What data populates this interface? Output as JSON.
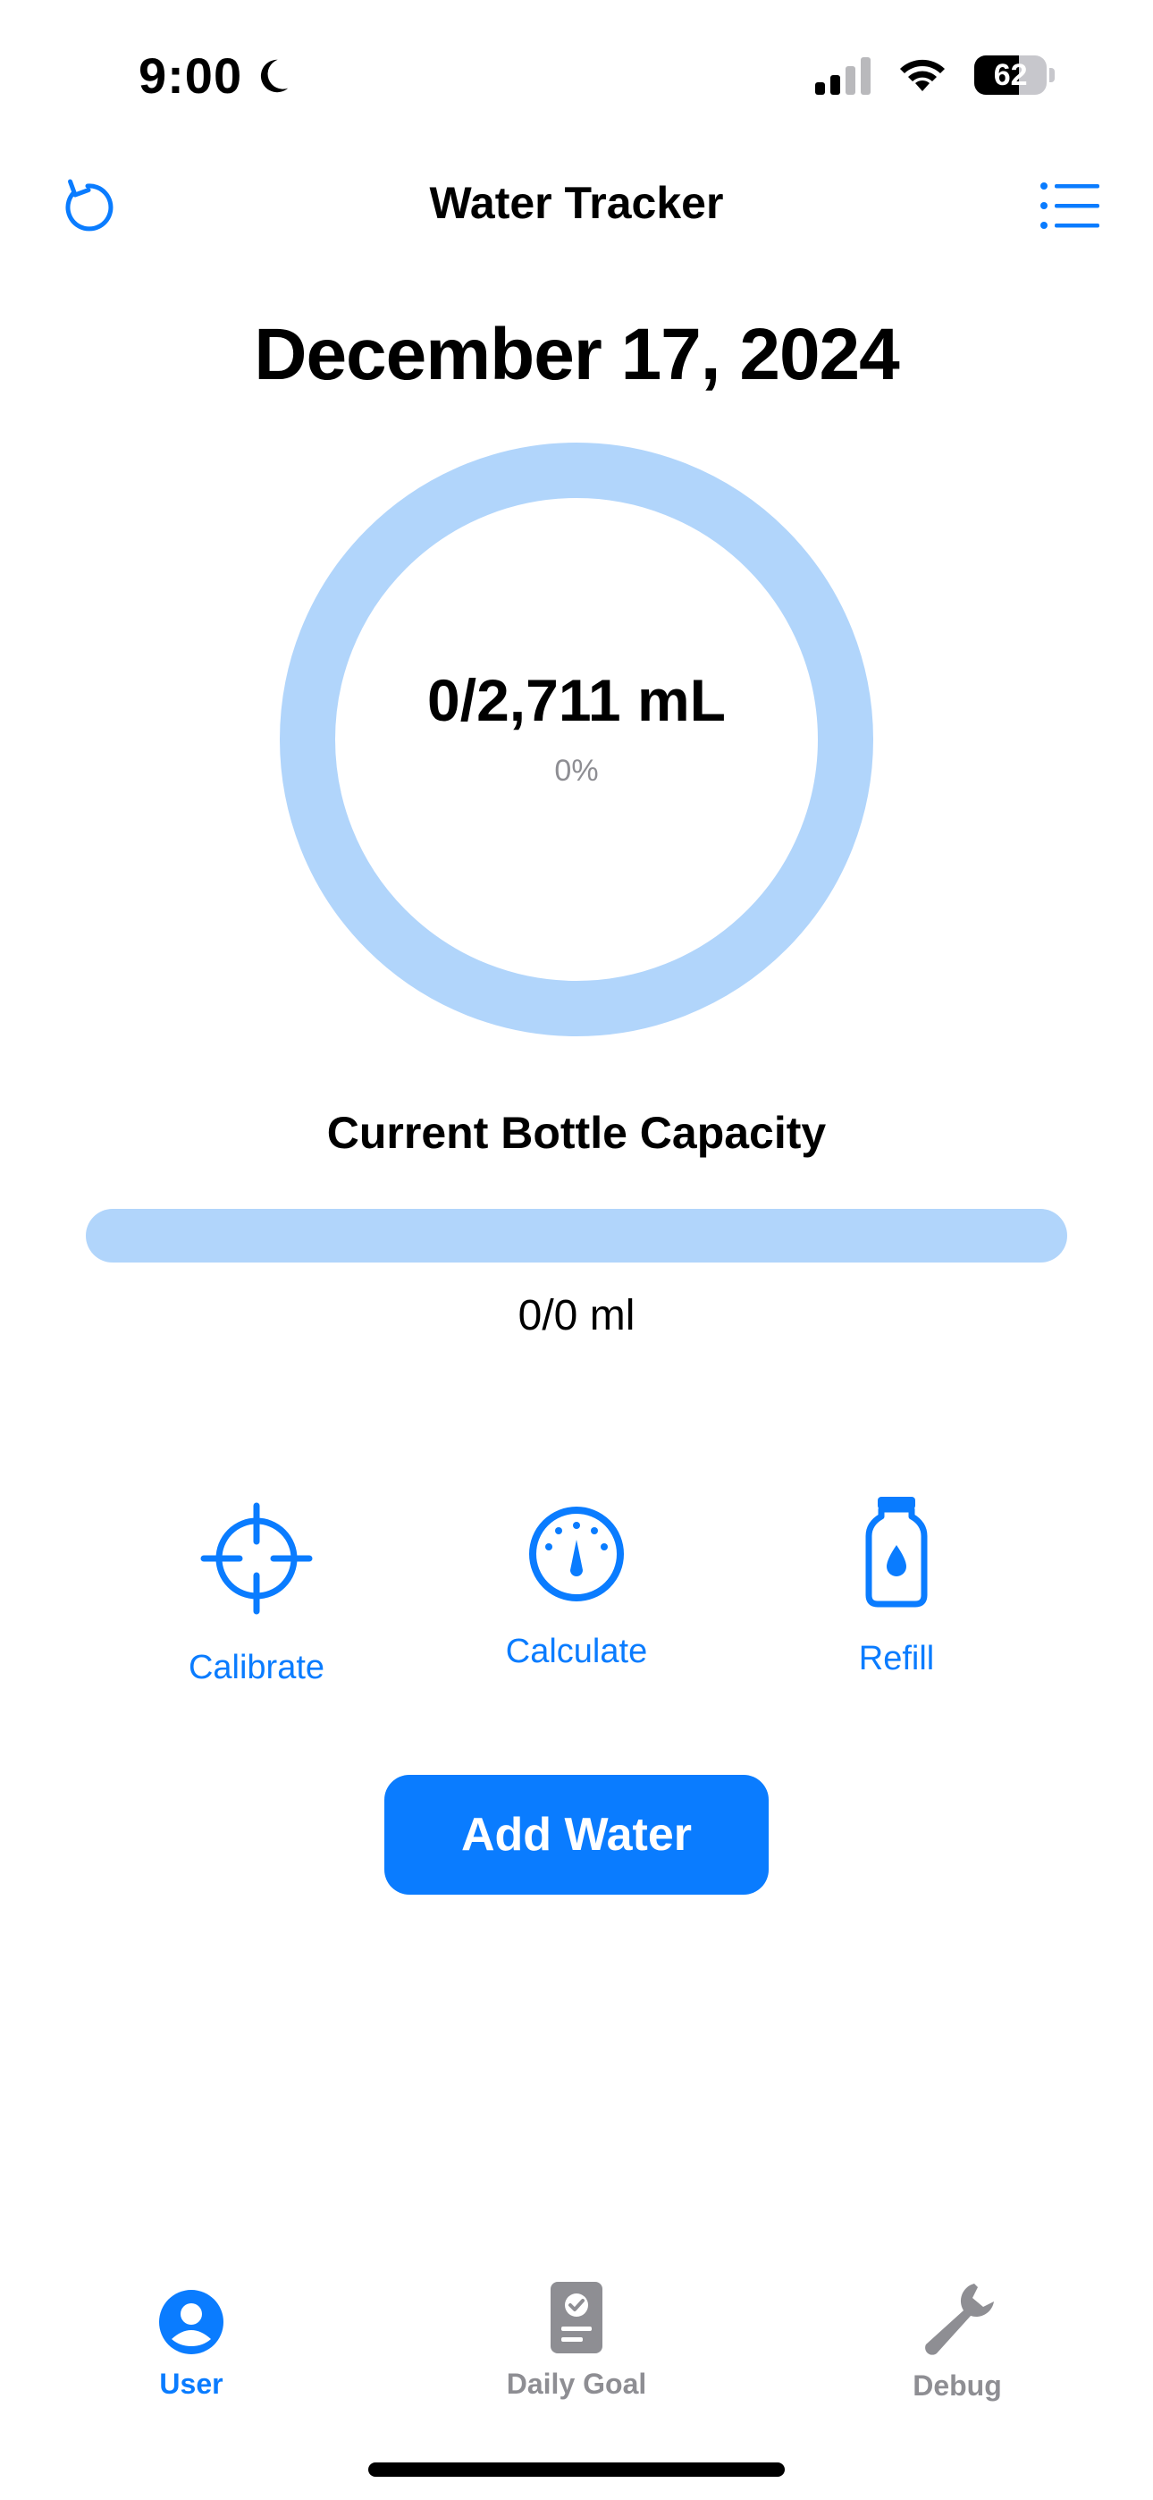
{
  "status_bar": {
    "time": "9:00",
    "battery_level": "62",
    "icons": [
      "moon-icon",
      "cellular-signal-icon",
      "wifi-icon",
      "battery-icon"
    ]
  },
  "nav": {
    "title": "Water Tracker",
    "left_icon": "reset-icon",
    "right_icon": "list-icon"
  },
  "date": "December 17, 2024",
  "daily_progress": {
    "amount_text": "0/2,711 mL",
    "percent_text": "0%",
    "fraction": 0
  },
  "bottle": {
    "label": "Current Bottle Capacity",
    "value_text": "0/0 ml",
    "fraction": 0
  },
  "actions": [
    {
      "label": "Calibrate",
      "icon": "crosshair-icon"
    },
    {
      "label": "Calculate",
      "icon": "gauge-icon"
    },
    {
      "label": "Refill",
      "icon": "water-bottle-icon"
    }
  ],
  "add_button": {
    "label": "Add Water"
  },
  "tabs": [
    {
      "label": "User",
      "icon": "user-circle-icon",
      "active": true
    },
    {
      "label": "Daily Goal",
      "icon": "goal-document-icon",
      "active": false
    },
    {
      "label": "Debug",
      "icon": "wrench-icon",
      "active": false
    }
  ],
  "colors": {
    "accent": "#0a7cff",
    "ring_track": "#b1d5fb",
    "inactive_tab": "#8e8e93"
  }
}
